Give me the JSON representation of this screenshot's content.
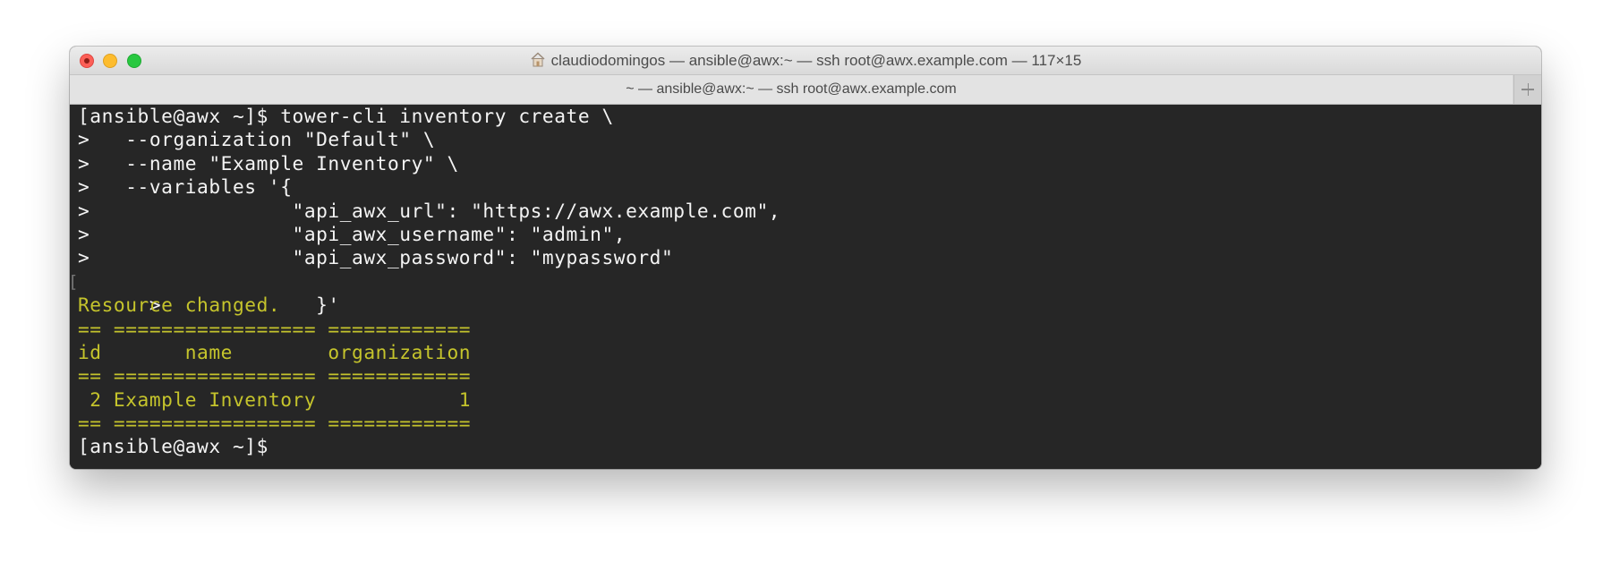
{
  "window": {
    "title": "claudiodomingos — ansible@awx:~ — ssh root@awx.example.com — 117×15",
    "tab_title": "~ — ansible@awx:~ — ssh root@awx.example.com",
    "home_icon": "home-icon",
    "new_tab_icon": "plus-icon"
  },
  "colors": {
    "terminal_background": "#262626",
    "terminal_text": "#f4f4f4",
    "output_text": "#c5c42c"
  },
  "terminal": {
    "lines": [
      "[ansible@awx ~]$ tower-cli inventory create \\",
      ">   --organization \"Default\" \\",
      ">   --name \"Example Inventory\" \\",
      ">   --variables '{",
      ">                 \"api_awx_url\": \"https://awx.example.com\",",
      ">                 \"api_awx_username\": \"admin\",",
      ">                 \"api_awx_password\": \"mypassword\"",
      ">             }'",
      "Resource changed.",
      "== ================= ============",
      "id       name        organization",
      "== ================= ============",
      " 2 Example Inventory            1",
      "== ================= ============",
      "[ansible@awx ~]$ "
    ],
    "marked_line_left": "[",
    "marked_line_right": "]"
  }
}
